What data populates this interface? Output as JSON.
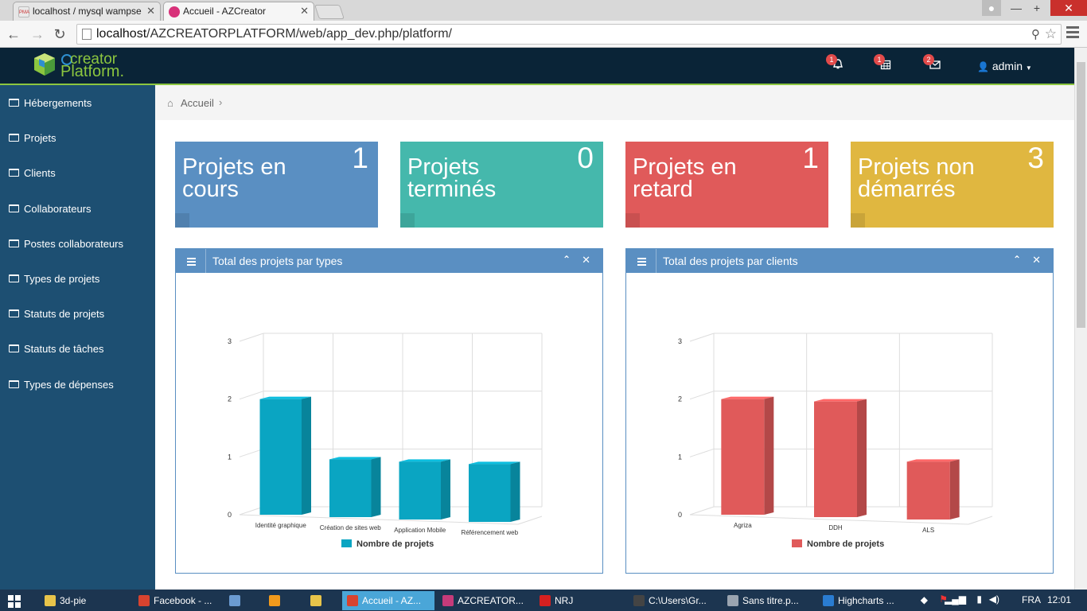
{
  "browser": {
    "tabs": [
      {
        "title": "localhost / mysql wampse",
        "favicon": "phpmyadmin-icon",
        "favicon_text": "PMA"
      },
      {
        "title": "Accueil - AZCreator",
        "favicon": "azcreator-icon"
      }
    ],
    "address_host": "localhost",
    "address_path": "/AZCREATORPLATFORM/web/app_dev.php/platform/"
  },
  "header": {
    "logo_line1": "creator",
    "logo_line2": "Platform.",
    "notifications": {
      "bell_count": "1",
      "calendar_count": "1",
      "mail_count": "2"
    },
    "user": "admin"
  },
  "sidebar": {
    "items": [
      {
        "label": "Hébergements"
      },
      {
        "label": "Projets"
      },
      {
        "label": "Clients"
      },
      {
        "label": "Collaborateurs"
      },
      {
        "label": "Postes collaborateurs"
      },
      {
        "label": "Types de projets"
      },
      {
        "label": "Statuts de projets"
      },
      {
        "label": "Statuts de tâches"
      },
      {
        "label": "Types de dépenses"
      }
    ]
  },
  "breadcrumb": {
    "home": "Accueil"
  },
  "stats": [
    {
      "label": "Projets en cours",
      "value": "1",
      "color": "#5a8fc2"
    },
    {
      "label": "Projets terminés",
      "value": "0",
      "color": "#45b8ac"
    },
    {
      "label": "Projets en retard",
      "value": "1",
      "color": "#e05a5a"
    },
    {
      "label": "Projets non démarrés",
      "value": "3",
      "color": "#e0b740"
    }
  ],
  "panels": [
    {
      "title": "Total des projets par types"
    },
    {
      "title": "Total des projets par clients"
    }
  ],
  "chart_data": [
    {
      "type": "bar",
      "title": "",
      "categories": [
        "Identité graphique",
        "Création de sites web",
        "Application Mobile",
        "Référencement web"
      ],
      "series": [
        {
          "name": "Nombre de projets",
          "values": [
            2,
            1,
            1,
            1
          ],
          "color": "#0aa5c2"
        }
      ],
      "ylim": [
        0,
        3
      ],
      "yticks": [
        "0",
        "1",
        "2",
        "3"
      ],
      "grid": true,
      "legend": "bottom"
    },
    {
      "type": "bar",
      "title": "",
      "categories": [
        "Agriza",
        "DDH",
        "ALS"
      ],
      "series": [
        {
          "name": "Nombre de projets",
          "values": [
            2,
            2,
            1
          ],
          "color": "#e05a5a"
        }
      ],
      "ylim": [
        0,
        3
      ],
      "yticks": [
        "0",
        "1",
        "2",
        "3"
      ],
      "grid": true,
      "legend": "bottom"
    }
  ],
  "taskbar": {
    "items": [
      {
        "label": "3d-pie",
        "icon": "folder-icon",
        "color": "#e8c44a"
      },
      {
        "label": "Facebook - ...",
        "icon": "chrome-icon",
        "color": "#d8432f"
      },
      {
        "label": "",
        "icon": "monitor-icon",
        "color": "#6b9bd1"
      },
      {
        "label": "",
        "icon": "media-player-icon",
        "color": "#f19a1c"
      },
      {
        "label": "",
        "icon": "calculator-icon",
        "color": "#e8c44a"
      },
      {
        "label": "Accueil - AZ...",
        "icon": "chrome-icon",
        "color": "#d8432f"
      },
      {
        "label": "AZCREATOR...",
        "icon": "phpstorm-icon",
        "color": "#c63b7a"
      },
      {
        "label": "NRJ",
        "icon": "nrj-icon",
        "color": "#d62020"
      },
      {
        "label": "C:\\Users\\Gr...",
        "icon": "terminal-icon",
        "color": "#444444"
      },
      {
        "label": "Sans titre.p...",
        "icon": "paint-icon",
        "color": "#9aa4b0"
      },
      {
        "label": "Highcharts ...",
        "icon": "firefox-icon",
        "color": "#2a7cd1"
      }
    ],
    "tray": {
      "language": "FRA",
      "time": "12:01"
    }
  }
}
